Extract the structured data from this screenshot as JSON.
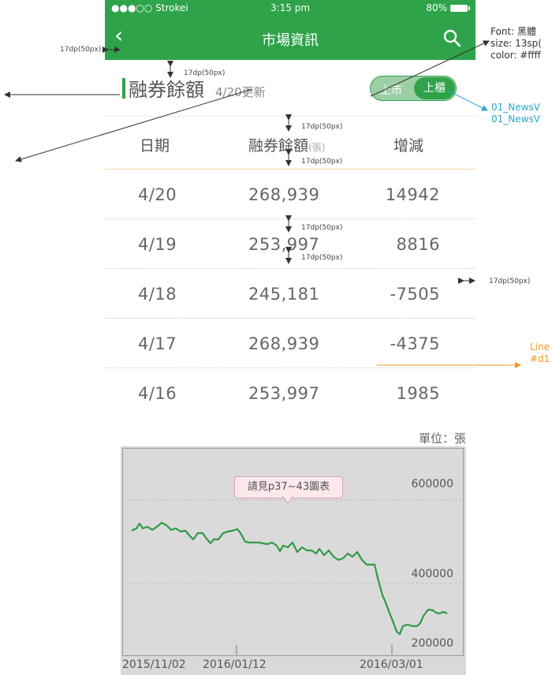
{
  "status_bar": {
    "carrier": "●●●○○ Strokei ",
    "time": "3:15 pm",
    "battery": "80%"
  },
  "nav": {
    "title": "市場資訊",
    "back_icon": "chevron-left-icon",
    "search_icon": "search-icon"
  },
  "section": {
    "title": "融券餘額",
    "updated": "4/20更新"
  },
  "toggle": {
    "option_1": "上市",
    "option_2": "上櫃",
    "selected": "上櫃"
  },
  "table": {
    "headers": {
      "date": "日期",
      "amount": "融券餘額",
      "amount_unit": "(張)",
      "change": "增減"
    },
    "rows": [
      {
        "date": "4/20",
        "amount": "268,939",
        "change": "14942"
      },
      {
        "date": "4/19",
        "amount": "253,997",
        "change": "8816"
      },
      {
        "date": "4/18",
        "amount": "245,181",
        "change": "-7505"
      },
      {
        "date": "4/17",
        "amount": "268,939",
        "change": "-4375"
      },
      {
        "date": "4/16",
        "amount": "253,997",
        "change": "1985"
      }
    ]
  },
  "unit_label": "單位：張",
  "chart": {
    "callout": "請見p37~43圖表",
    "y_labels": [
      "600000",
      "400000",
      "200000"
    ],
    "x_labels": [
      "2015/11/02",
      "2016/01/12",
      "2016/03/01"
    ],
    "line_color": "#2e9a45"
  },
  "annotations": {
    "spacing": "17dp(50px)",
    "font_spec": [
      "Font: 黑體",
      "size: 13sp(",
      "color: #ffff"
    ],
    "news_ref": [
      "01_NewsV",
      "01_NewsV"
    ],
    "line_spec": [
      "Line",
      "#d1"
    ]
  },
  "colors": {
    "brand_green": "#2ea34a",
    "toggle_light": "#9ccfa5",
    "annotation_blue": "#2aa6c9",
    "annotation_orange": "#f39a1b"
  }
}
